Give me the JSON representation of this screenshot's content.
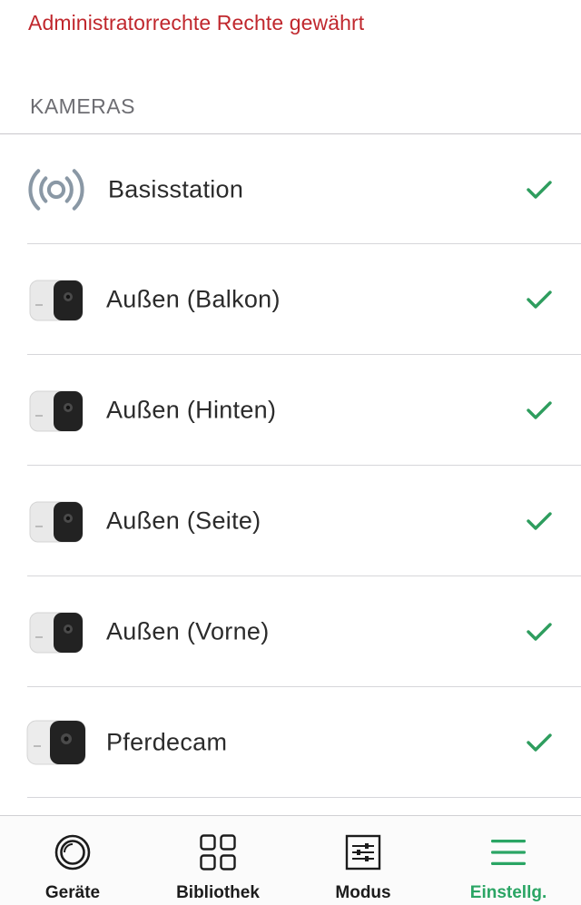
{
  "notice": {
    "text": "Administratorrechte Rechte gewährt",
    "color": "#c0272d"
  },
  "section": {
    "title": "KAMERAS"
  },
  "devices": [
    {
      "label": "Basisstation",
      "icon": "base-station-icon",
      "checked": true
    },
    {
      "label": "Außen (Balkon)",
      "icon": "camera-icon",
      "checked": true
    },
    {
      "label": "Außen (Hinten)",
      "icon": "camera-icon",
      "checked": true
    },
    {
      "label": "Außen (Seite)",
      "icon": "camera-icon",
      "checked": true
    },
    {
      "label": "Außen (Vorne)",
      "icon": "camera-icon",
      "checked": true
    },
    {
      "label": "Pferdecam",
      "icon": "camera-icon",
      "checked": true
    }
  ],
  "tabs": [
    {
      "label": "Geräte",
      "icon": "devices-icon",
      "active": false
    },
    {
      "label": "Bibliothek",
      "icon": "library-grid-icon",
      "active": false
    },
    {
      "label": "Modus",
      "icon": "mode-sliders-icon",
      "active": false
    },
    {
      "label": "Einstellg.",
      "icon": "menu-icon",
      "active": true
    }
  ],
  "colors": {
    "accent": "#2aa564",
    "check": "#2e9d5e",
    "separator": "#d6d6da"
  }
}
